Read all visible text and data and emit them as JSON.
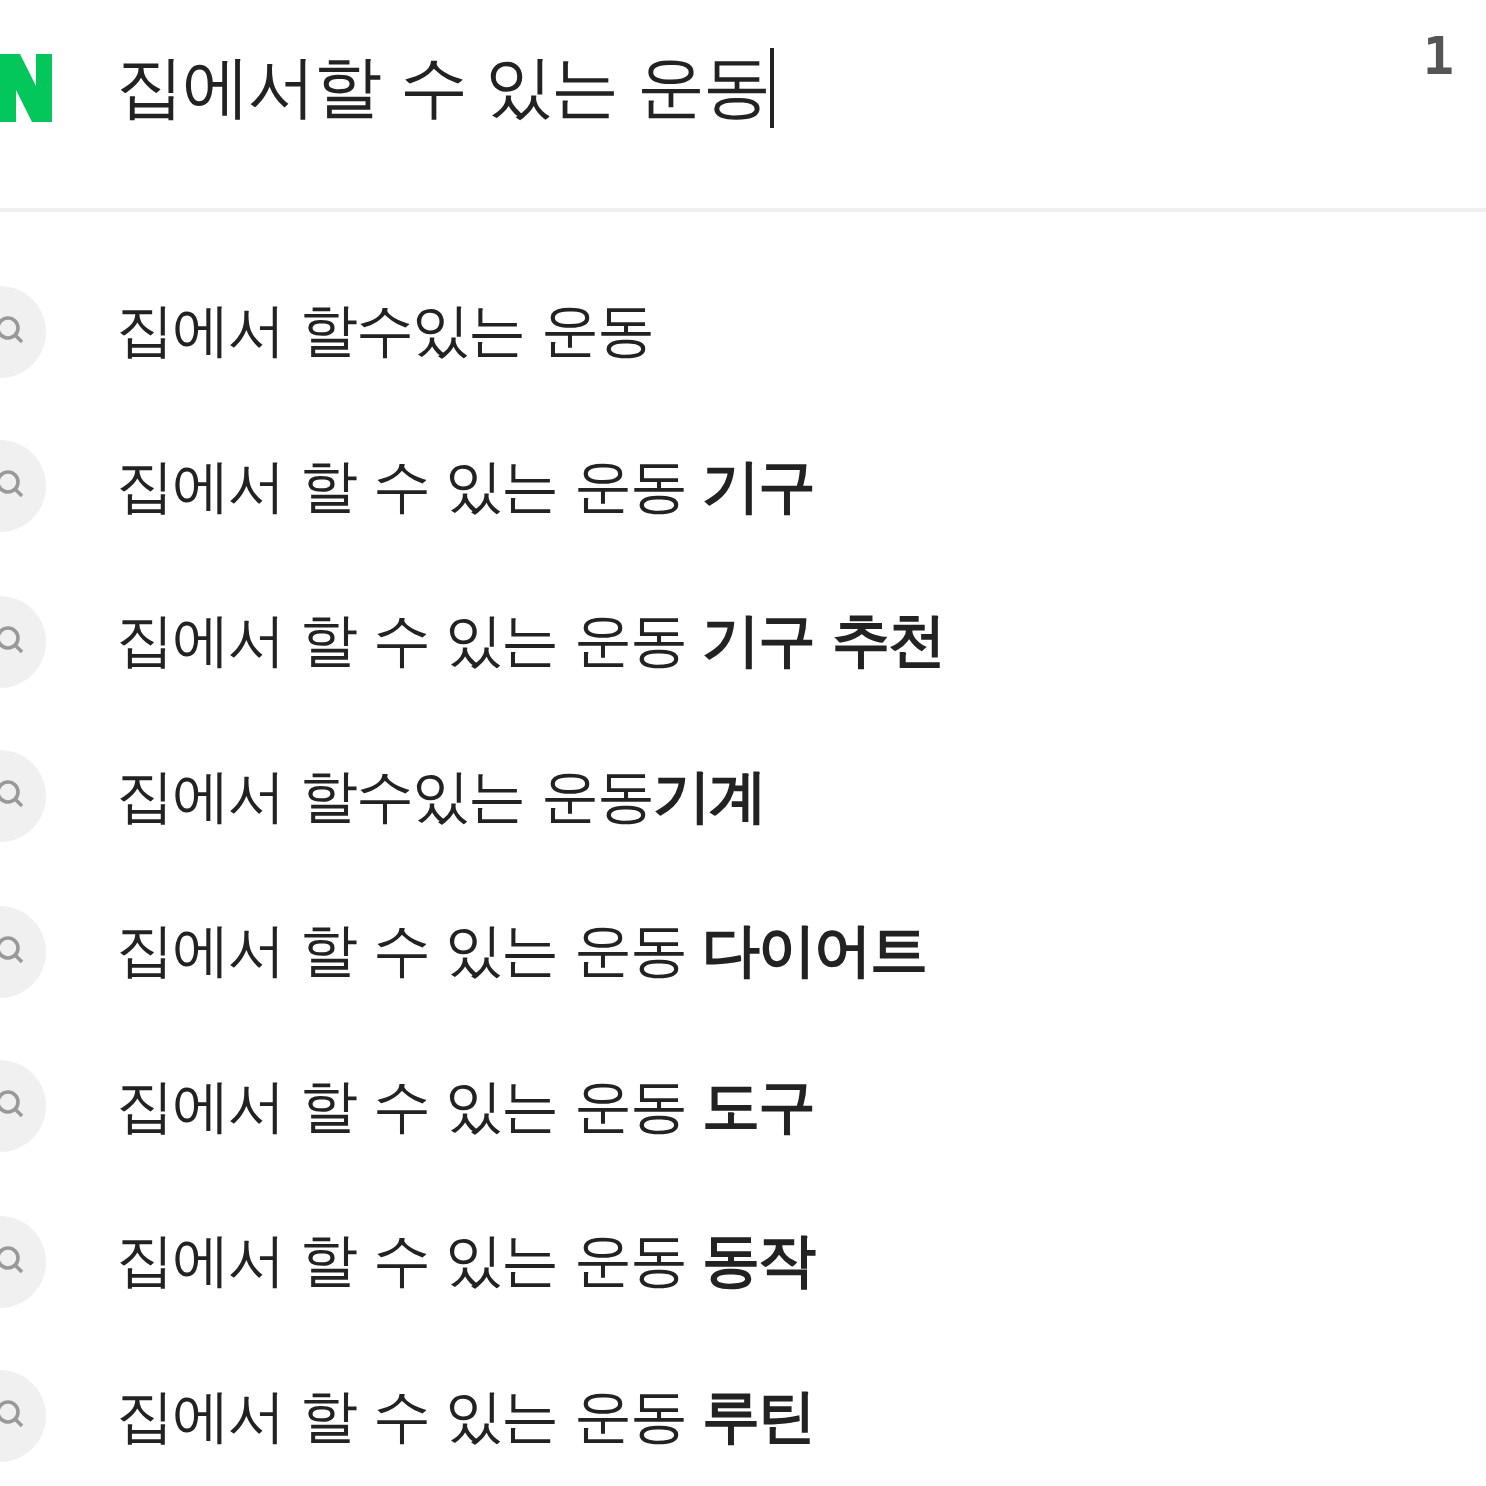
{
  "search": {
    "value": "집에서할 수 있는 운동",
    "counter": "1"
  },
  "suggestions": [
    {
      "text": "집에서 할수있는 운동"
    },
    {
      "text": "집에서 할 수 있는 운동 **기구**"
    },
    {
      "text": "집에서 할 수 있는 운동 **기구 추천**"
    },
    {
      "text": "집에서 할수있는 운동**기계**"
    },
    {
      "text": "집에서 할 수 있는 운동 **다이어트**"
    },
    {
      "text": "집에서 할 수 있는 운동 **도구**"
    },
    {
      "text": "집에서 할 수 있는 운동 **동작**"
    },
    {
      "text": "집에서 할 수 있는 운동 **루틴**"
    }
  ]
}
